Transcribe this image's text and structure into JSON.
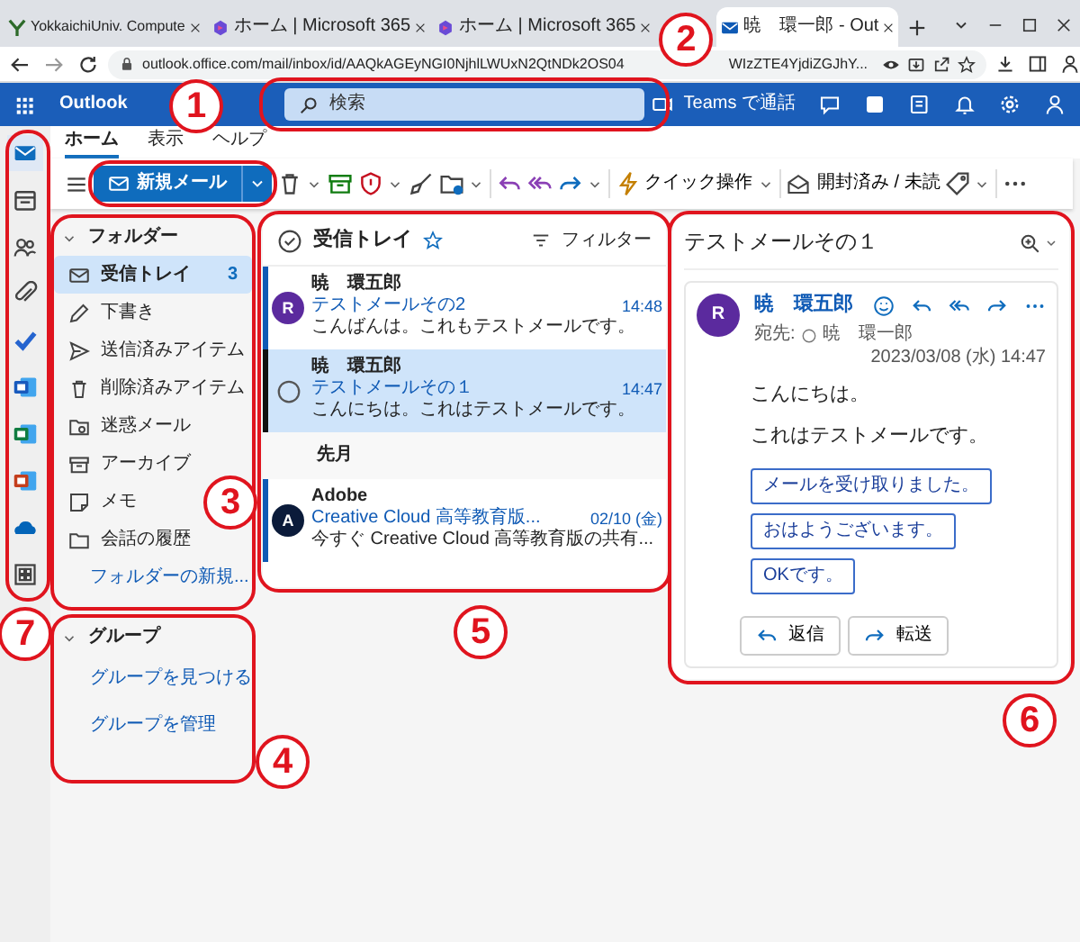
{
  "browser": {
    "tabs": [
      {
        "title": "YokkaichiUniv. Compute",
        "kind": "site",
        "selected": false
      },
      {
        "title": "ホーム | Microsoft 365",
        "kind": "m365",
        "selected": false
      },
      {
        "title": "ホーム | Microsoft 365",
        "kind": "m365",
        "selected": false
      },
      {
        "title": "暁　環一郎 - Out",
        "kind": "outlook",
        "selected": true
      }
    ],
    "url": "outlook.office.com/mail/inbox/id/AAQkAGEyNGI0NjhlLWUxN2QtNDk2OS04",
    "url_tail": "WIzZTE4YjdiZGJhY..."
  },
  "app": {
    "name": "Outlook",
    "search": {
      "placeholder": "検索"
    },
    "teams_label": "Teams で通話"
  },
  "ribbon": {
    "tabs": [
      {
        "label": "ホーム",
        "selected": true
      },
      {
        "label": "表示",
        "selected": false
      },
      {
        "label": "ヘルプ",
        "selected": false
      }
    ],
    "new_mail": "新規メール",
    "quick_steps": "クイック操作",
    "read_unread": "開封済み / 未読"
  },
  "rail": [
    {
      "kind": "mail",
      "selected": true
    },
    {
      "kind": "calendar",
      "selected": false
    },
    {
      "kind": "people",
      "selected": false
    },
    {
      "kind": "paperclip",
      "selected": false
    },
    {
      "kind": "todo",
      "selected": false
    },
    {
      "kind": "word",
      "selected": false
    },
    {
      "kind": "excel",
      "selected": false
    },
    {
      "kind": "powerpoint",
      "selected": false
    },
    {
      "kind": "onedrive",
      "selected": false
    },
    {
      "kind": "apps",
      "selected": false
    }
  ],
  "folders": {
    "header": "フォルダー",
    "expanded": true,
    "items": [
      {
        "kind": "inbox",
        "label": "受信トレイ",
        "count": "3",
        "selected": true
      },
      {
        "kind": "drafts",
        "label": "下書き",
        "selected": false
      },
      {
        "kind": "sent",
        "label": "送信済みアイテム",
        "selected": false
      },
      {
        "kind": "deleted",
        "label": "削除済みアイテム",
        "selected": false
      },
      {
        "kind": "junk",
        "label": "迷惑メール",
        "selected": false
      },
      {
        "kind": "archive",
        "label": "アーカイブ",
        "selected": false
      },
      {
        "kind": "notes",
        "label": "メモ",
        "selected": false
      },
      {
        "kind": "history",
        "label": "会話の履歴",
        "selected": false
      }
    ],
    "new_folder": "フォルダーの新規..."
  },
  "groups": {
    "header": "グループ",
    "expanded": true,
    "links": [
      "グループを見つける",
      "グループを管理"
    ]
  },
  "mail_list": {
    "title": "受信トレイ",
    "filter": "フィルター",
    "items": [
      {
        "kind": "mail",
        "sender": "暁　環五郎",
        "subject": "テストメールその2",
        "time": "14:48",
        "preview": "こんばんは。これもテストメールです。",
        "avatar": "R",
        "color": "#5b2a9e",
        "selected": false
      },
      {
        "kind": "mail",
        "sender": "暁　環五郎",
        "subject": "テストメールその１",
        "time": "14:47",
        "preview": "こんにちは。これはテストメールです。",
        "selected": true
      },
      {
        "kind": "heading",
        "label": "先月"
      },
      {
        "kind": "mail",
        "sender": "Adobe",
        "subject": "Creative Cloud 高等教育版...",
        "time": "02/10 (金)",
        "preview": "今すぐ Creative Cloud 高等教育版の共有...",
        "avatar": "A",
        "color": "#0b1b3a",
        "selected": false
      }
    ]
  },
  "reading": {
    "subject": "テストメールその１",
    "sender": "暁　環五郎",
    "avatar": "R",
    "to_label": "宛先:",
    "to": "暁　環一郎",
    "date": "2023/03/08 (水) 14:47",
    "body": [
      "こんにちは。",
      "これはテストメールです。"
    ],
    "suggestions": [
      "メールを受け取りました。",
      "おはようございます。",
      "OKです。"
    ],
    "actions": [
      {
        "kind": "reply",
        "label": "返信"
      },
      {
        "kind": "forward",
        "label": "転送"
      }
    ]
  },
  "annotations": [
    {
      "label": "1"
    },
    {
      "label": "2"
    },
    {
      "label": "3"
    },
    {
      "label": "4"
    },
    {
      "label": "5"
    },
    {
      "label": "6"
    },
    {
      "label": "7"
    }
  ]
}
